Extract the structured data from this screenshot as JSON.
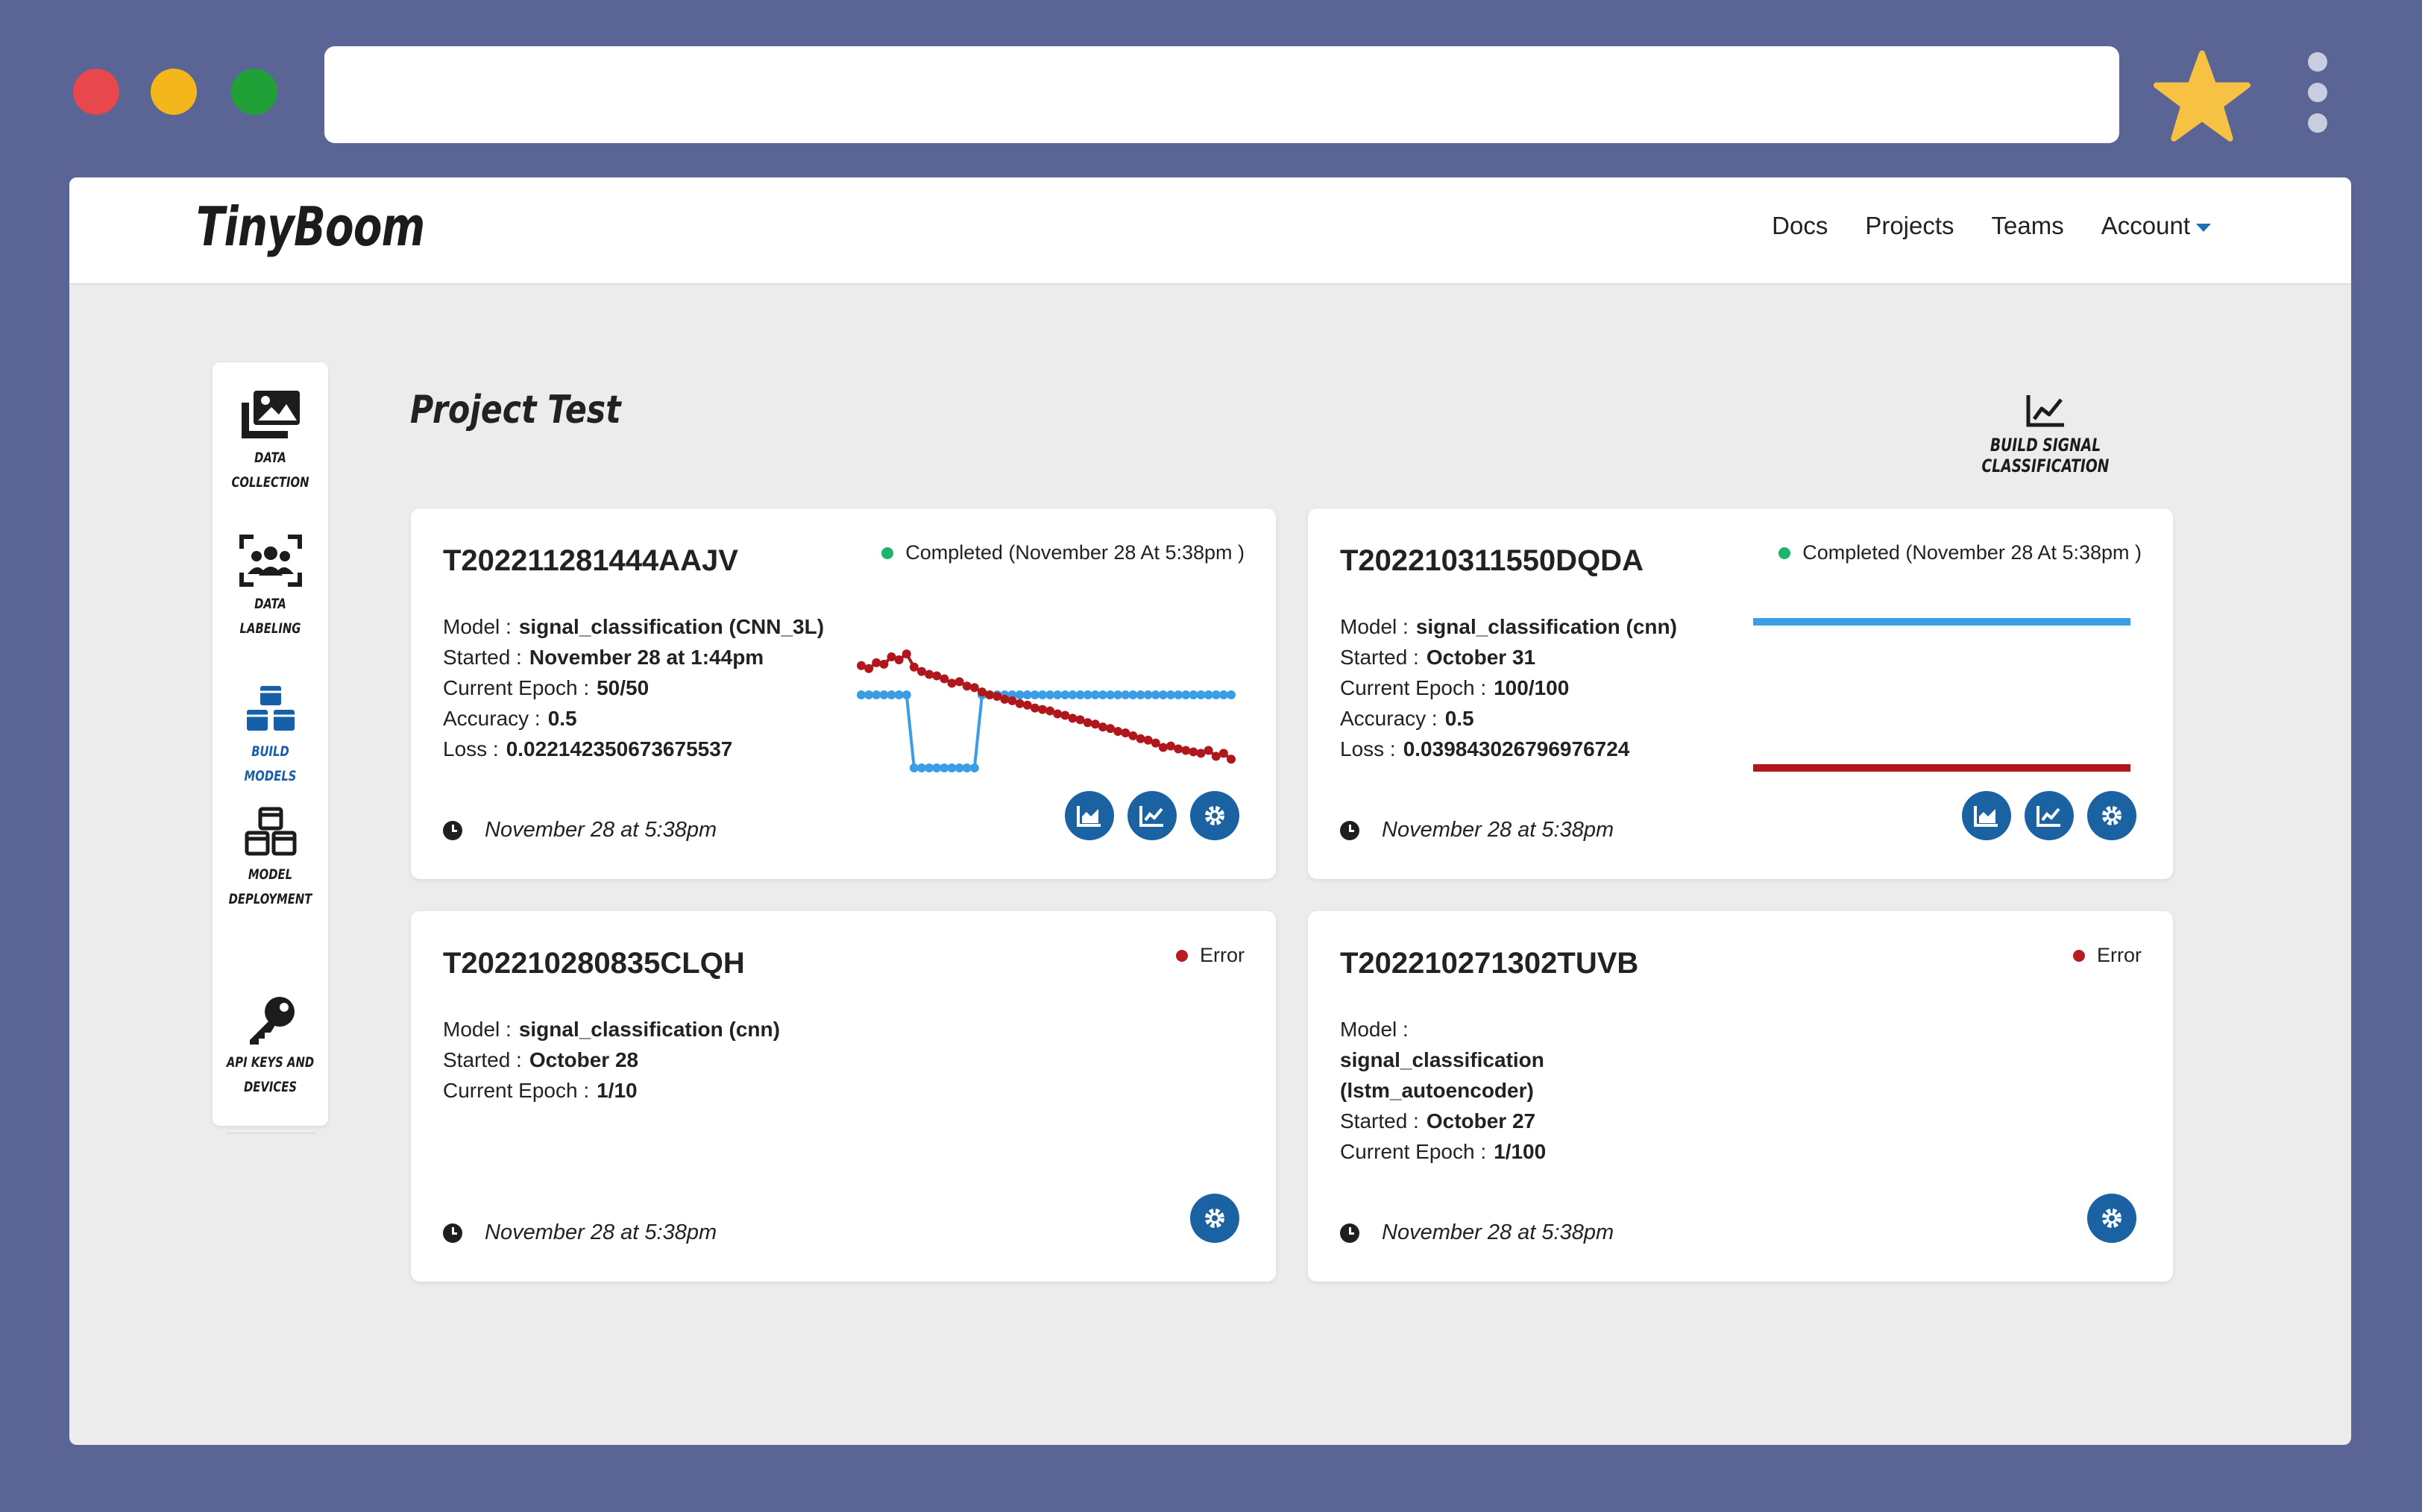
{
  "app": {
    "logo": "TinyBoom"
  },
  "nav": {
    "docs": "Docs",
    "projects": "Projects",
    "teams": "Teams",
    "account": "Account"
  },
  "sidebar": {
    "items": [
      {
        "line1": "DATA",
        "line2": "COLLECTION"
      },
      {
        "line1": "DATA",
        "line2": "LABELING"
      },
      {
        "line1": "BUILD MODELS",
        "line2": ""
      },
      {
        "line1": "MODEL",
        "line2": "DEPLOYMENT"
      },
      {
        "line1": "API KEYS AND",
        "line2": "DEVICES"
      }
    ]
  },
  "page": {
    "title": "Project Test",
    "build_label": "BUILD SIGNAL CLASSIFICATION"
  },
  "labels": {
    "model": "Model :",
    "started": "Started :",
    "epoch": "Current Epoch :",
    "accuracy": "Accuracy :",
    "loss": "Loss :"
  },
  "colors": {
    "completed": "#1fb36b",
    "error": "#b81b20",
    "accent": "#1a62a2",
    "series_blue": "#3a9ee6",
    "series_red": "#b0171c"
  },
  "cards": [
    {
      "id": "T202211281444AAJV",
      "status": "Completed (November 28 At 5:38pm )",
      "model": "signal_classification (CNN_3L)",
      "started": "November 28 at 1:44pm",
      "epoch": "50/50",
      "accuracy": "0.5",
      "loss": "0.022142350673675537",
      "time": "November 28 at 5:38pm"
    },
    {
      "id": "T202210311550DQDA",
      "status": "Completed (November 28 At 5:38pm )",
      "model": "signal_classification (cnn)",
      "started": "October 31",
      "epoch": "100/100",
      "accuracy": "0.5",
      "loss": "0.039843026796976724",
      "time": "November 28 at 5:38pm"
    },
    {
      "id": "T202210280835CLQH",
      "status": "Error",
      "model": "signal_classification (cnn)",
      "started": "October 28",
      "epoch": "1/10",
      "time": "November 28 at 5:38pm"
    },
    {
      "id": "T202210271302TUVB",
      "status": "Error",
      "model_line1": "signal_classification",
      "model_line2": "(lstm_autoencoder)",
      "started": "October 27",
      "epoch": "1/100",
      "time": "November 28 at 5:38pm"
    }
  ],
  "chart_data": [
    {
      "type": "line",
      "series": [
        {
          "values": [
            0.5,
            0.5,
            0.5,
            0.5,
            0.5,
            0.5,
            0.5,
            0.0,
            0.0,
            0.0,
            0.0,
            0.0,
            0.0,
            0.0,
            0.0,
            0.0,
            0.5,
            0.5,
            0.5,
            0.5,
            0.5,
            0.5,
            0.5,
            0.5,
            0.5,
            0.5,
            0.5,
            0.5,
            0.5,
            0.5,
            0.5,
            0.5,
            0.5,
            0.5,
            0.5,
            0.5,
            0.5,
            0.5,
            0.5,
            0.5,
            0.5,
            0.5,
            0.5,
            0.5,
            0.5,
            0.5,
            0.5,
            0.5,
            0.5,
            0.5
          ]
        },
        {
          "values": [
            0.7,
            0.68,
            0.72,
            0.71,
            0.76,
            0.74,
            0.78,
            0.69,
            0.66,
            0.64,
            0.63,
            0.61,
            0.58,
            0.59,
            0.56,
            0.55,
            0.52,
            0.5,
            0.49,
            0.47,
            0.46,
            0.44,
            0.43,
            0.41,
            0.4,
            0.39,
            0.37,
            0.36,
            0.34,
            0.33,
            0.31,
            0.3,
            0.28,
            0.27,
            0.25,
            0.24,
            0.22,
            0.2,
            0.19,
            0.17,
            0.14,
            0.15,
            0.13,
            0.12,
            0.11,
            0.1,
            0.12,
            0.08,
            0.1,
            0.06
          ]
        }
      ]
    },
    {
      "type": "line",
      "series": [
        {
          "values": [
            1.0,
            1.0,
            1.0,
            1.0,
            1.0,
            1.0,
            1.0,
            1.0,
            1.0,
            1.0
          ]
        },
        {
          "values": [
            0.0,
            0.0,
            0.0,
            0.0,
            0.0,
            0.0,
            0.0,
            0.0,
            0.0,
            0.0
          ]
        }
      ]
    }
  ]
}
